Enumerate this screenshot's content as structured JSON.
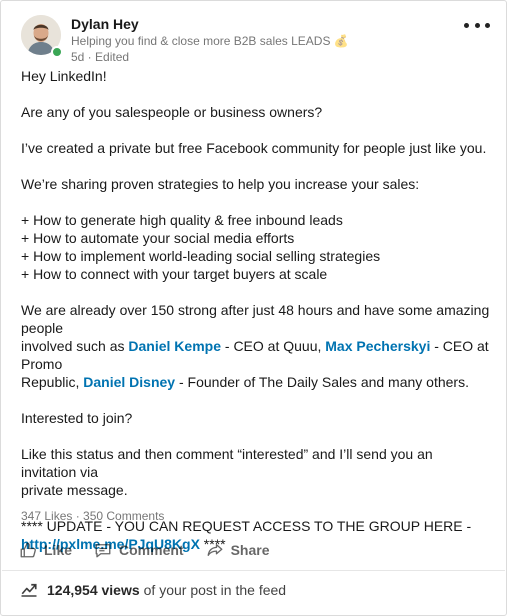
{
  "post": {
    "author": "Dylan Hey",
    "headline": "Helping you find & close more B2B sales LEADS",
    "headline_emoji": "💰",
    "meta": "5d · Edited",
    "body": {
      "greeting": "Hey LinkedIn!",
      "question": "Are any of you salespeople or business owners?",
      "created": "I’ve created a private but free Facebook community for people just like you.",
      "sharing": "We’re sharing proven strategies to help you increase your sales:",
      "bullets": [
        "+ How to generate high quality & free inbound leads",
        "+ How to automate your social media efforts",
        "+ How to implement world-leading social selling strategies",
        "+ How to connect with your target buyers at scale"
      ],
      "strong_line1": "We are already over 150 strong after just 48 hours and have some amazing people",
      "strong_pre": "involved such as ",
      "person1": "Daniel Kempe",
      "person1_role": " - CEO at Quuu, ",
      "person2": "Max Pecherskyi",
      "person2_role": " - CEO at Promo",
      "strong_line3_pre": "Republic, ",
      "person3": "Daniel Disney",
      "person3_role": " - Founder of The Daily Sales and many others.",
      "interested": "Interested to join?",
      "cta_line1": "Like this status and then comment “interested” and I’ll send you an invitation via",
      "cta_line2": "private message.",
      "update_line": "**** UPDATE - YOU CAN REQUEST ACCESS TO THE GROUP HERE -",
      "update_link": "http://pxlme.me/PJqU8KgX",
      "update_suffix": " ****"
    },
    "counts": "347 Likes · 350 Comments",
    "actions": {
      "like": "Like",
      "comment": "Comment",
      "share": "Share"
    },
    "views": {
      "count": "124,954 views",
      "suffix": "of your post in the feed"
    },
    "colors": {
      "link": "#0073b1",
      "presence": "#3aa655"
    }
  }
}
